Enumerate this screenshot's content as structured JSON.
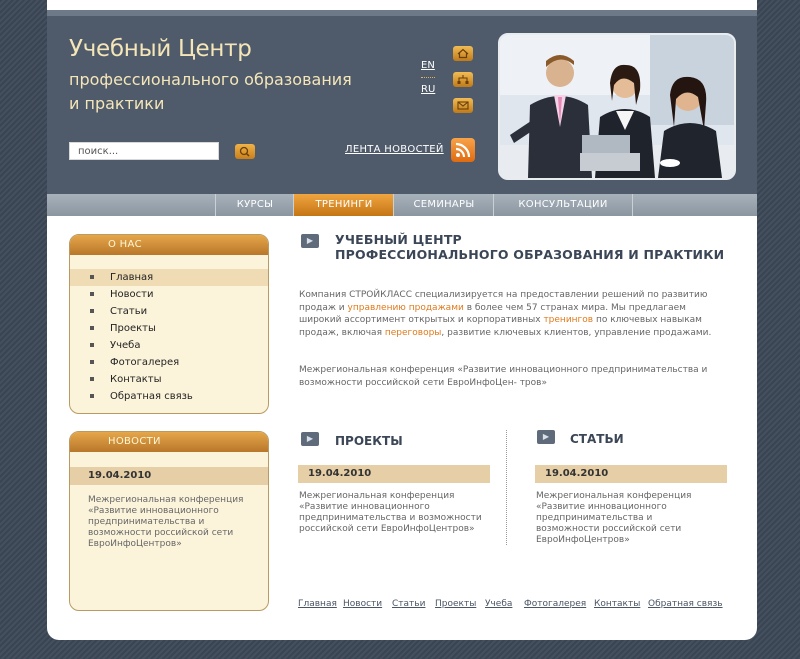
{
  "header": {
    "title": "Учебный Центр",
    "subtitle_line1": "профессионального образования",
    "subtitle_line2": "и практики",
    "search_placeholder": "поиск...",
    "lang_en": "EN",
    "lang_ru": "RU",
    "news_feed_label": "ЛЕНТА НОВОСТЕЙ"
  },
  "nav": {
    "items": [
      {
        "label": "КУРСЫ"
      },
      {
        "label": "ТРЕНИНГИ"
      },
      {
        "label": "СЕМИНАРЫ"
      },
      {
        "label": "КОНСУЛЬТАЦИИ"
      }
    ]
  },
  "sidebar": {
    "about": {
      "title": "О НАС",
      "items": [
        {
          "label": "Главная"
        },
        {
          "label": "Новости"
        },
        {
          "label": "Статьи"
        },
        {
          "label": "Проекты"
        },
        {
          "label": "Учеба"
        },
        {
          "label": "Фотогалерея"
        },
        {
          "label": "Контакты"
        },
        {
          "label": "Обратная связь"
        }
      ]
    },
    "news": {
      "title": "НОВОСТИ",
      "date": "19.04.2010",
      "text": "Межрегиональная конференция «Развитие инновационного предпринимательства и возможности российской сети ЕвроИнфоЦентров»"
    }
  },
  "main": {
    "heading_line1": "УЧЕБНЫЙ ЦЕНТР",
    "heading_line2": "ПРОФЕССИОНАЛЬНОГО ОБРАЗОВАНИЯ И ПРАКТИКИ",
    "paragraph_1a": "Компания СТРОЙКЛАСС специализируется на предоставлении решений по развитию продаж и ",
    "link_sales_mgmt": "управлению продажами",
    "paragraph_1b": " в более чем 57 странах мира. Мы предлагаем широкий ассортимент открытых и корпоративных ",
    "link_trainings": "тренингов",
    "paragraph_1c": " по ключевых навыкам продаж, включая ",
    "link_negotiations": "переговоры",
    "paragraph_1d": ", развитие ключевых клиентов, управление продажами.",
    "paragraph_2": "Межрегиональная конференция «Развитие инновационного предпринимательства и возможности российской сети ЕвроИнфоЦен- тров»",
    "projects": {
      "title": "ПРОЕКТЫ",
      "date": "19.04.2010",
      "text": "Межрегиональная конференция «Развитие инновационного предпринимательства и возможности российской сети ЕвроИнфоЦентров»"
    },
    "articles": {
      "title": "СТАТЬИ",
      "date": "19.04.2010",
      "text": "Межрегиональная конференция «Развитие инновационного предпринимательства и возможности российской сети ЕвроИнфоЦентров»"
    }
  },
  "footer": {
    "links": [
      {
        "label": "Главная"
      },
      {
        "label": "Новости"
      },
      {
        "label": "Статьи"
      },
      {
        "label": "Проекты"
      },
      {
        "label": "Учеба"
      },
      {
        "label": "Фотогалерея"
      },
      {
        "label": "Контакты"
      },
      {
        "label": "Обратная связь"
      }
    ]
  },
  "icons": {
    "home": "home-icon",
    "sitemap": "sitemap-icon",
    "mail": "mail-icon",
    "search": "search-icon",
    "rss": "rss-icon",
    "section": "section-icon",
    "bullet": "bullet-icon"
  },
  "colors": {
    "accent": "#d8902a",
    "header_bg": "#4f5b6b",
    "title": "#f5e6b8",
    "link": "#e07a1c"
  }
}
